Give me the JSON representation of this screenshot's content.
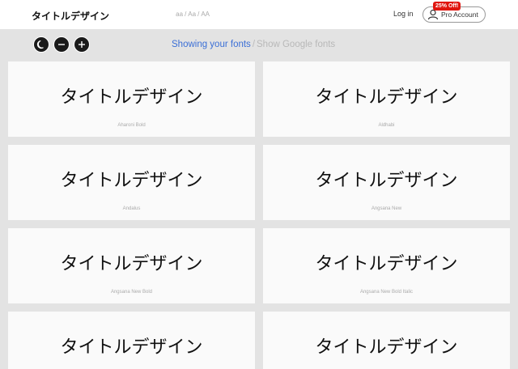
{
  "search": {
    "value": "タイトルデザイン",
    "case_options": [
      "aa",
      "Aa",
      "AA"
    ],
    "case_separator": "/"
  },
  "header": {
    "login_label": "Log in",
    "pro_label": "Pro Account",
    "pro_badge": "25% Off!"
  },
  "toolbar": {
    "dark_mode_icon": "moon-icon",
    "decrease_icon": "minus-icon",
    "increase_icon": "plus-icon"
  },
  "source_toggle": {
    "active": "Showing your fonts",
    "separator": "/",
    "inactive": "Show Google fonts"
  },
  "fonts": [
    {
      "sample": "タイトルデザイン",
      "name": "Aharoni Bold"
    },
    {
      "sample": "タイトルデザイン",
      "name": "Aldhabi"
    },
    {
      "sample": "タイトルデザイン",
      "name": "Andalus"
    },
    {
      "sample": "タイトルデザイン",
      "name": "Angsana New"
    },
    {
      "sample": "タイトルデザイン",
      "name": "Angsana New Bold"
    },
    {
      "sample": "タイトルデザイン",
      "name": "Angsana New Bold Italic"
    },
    {
      "sample": "タイトルデザイン",
      "name": ""
    },
    {
      "sample": "タイトルデザイン",
      "name": ""
    }
  ],
  "colors": {
    "accent": "#3b6fd6",
    "badge": "#e0160f",
    "background": "#e3e3e3",
    "card": "#fafafa"
  }
}
